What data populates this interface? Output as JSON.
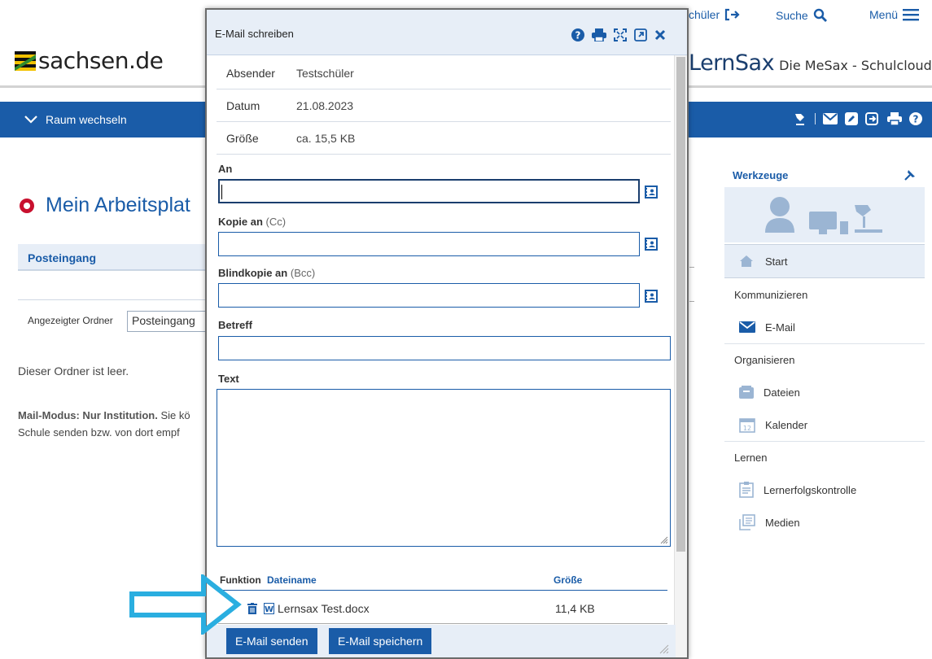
{
  "header": {
    "logo_text": "sachsen.de",
    "user_label": "chüler",
    "search_label": "Suche",
    "menu_label": "Menü",
    "brand_name": "LernSax",
    "brand_tagline": "Die MeSax - Schulcloud"
  },
  "bluebar": {
    "room_switch_label": "Raum wechseln"
  },
  "workspace": {
    "title": "Mein Arbeitsplat",
    "tab_inbox": "Posteingang",
    "folder_label": "Angezeigter Ordner",
    "folder_value": "Posteingang",
    "empty_text": "Dieser Ordner ist leer.",
    "mode_bold": "Mail-Modus: Nur Institution.",
    "mode_rest": " Sie kö Schule senden bzw. von dort empf"
  },
  "tools": {
    "title": "Werkzeuge",
    "start_label": "Start",
    "section_communicate": "Kommunizieren",
    "email_label": "E-Mail",
    "section_organize": "Organisieren",
    "files_label": "Dateien",
    "calendar_label": "Kalender",
    "calendar_day": "12",
    "section_learn": "Lernen",
    "assessment_label": "Lernerfolgskontrolle",
    "media_label": "Medien"
  },
  "modal": {
    "title": "E-Mail schreiben",
    "meta": [
      {
        "key": "Absender",
        "value": "Testschüler"
      },
      {
        "key": "Datum",
        "value": "21.08.2023"
      },
      {
        "key": "Größe",
        "value": "ca. 15,5 KB"
      }
    ],
    "to_label": "An",
    "cc_label": "Kopie an",
    "cc_sub": "(Cc)",
    "bcc_label": "Blindkopie an",
    "bcc_sub": "(Bcc)",
    "subject_label": "Betreff",
    "text_label": "Text",
    "to_value": "",
    "cc_value": "",
    "bcc_value": "",
    "subject_value": "",
    "body_value": "",
    "attachments": {
      "col_function": "Funktion",
      "col_filename": "Dateiname",
      "col_size": "Größe",
      "rows": [
        {
          "filename": "Lernsax Test.docx",
          "size": "11,4 KB"
        }
      ]
    },
    "send_button": "E-Mail senden",
    "save_button": "E-Mail speichern"
  },
  "colors": {
    "primary_blue": "#1a5ca8",
    "light_blue": "#e7eef7",
    "accent_red": "#c8102e",
    "arrow_cyan": "#2aaee0"
  }
}
